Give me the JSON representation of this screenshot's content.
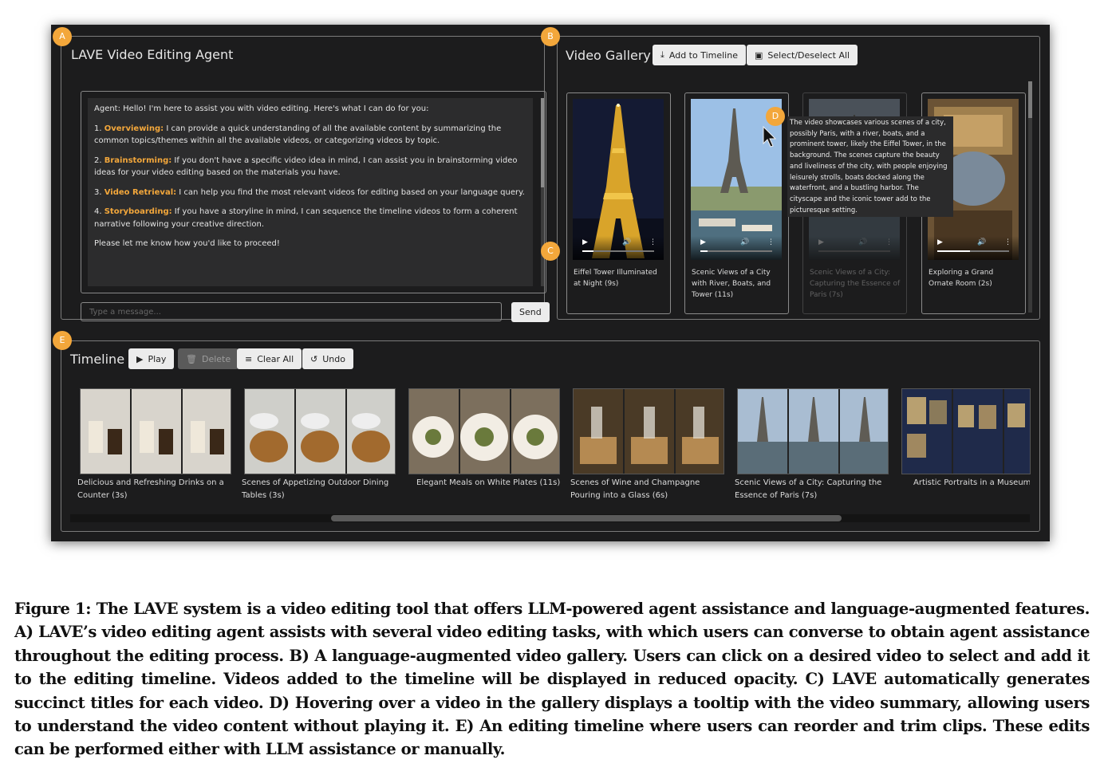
{
  "panels": {
    "A": {
      "badge": "A",
      "title": "LAVE Video Editing Agent"
    },
    "B": {
      "badge": "B",
      "title": "Video Gallery"
    },
    "C": {
      "badge": "C"
    },
    "D": {
      "badge": "D"
    },
    "E": {
      "badge": "E",
      "title": "Timeline"
    }
  },
  "chat": {
    "intro": "Agent: Hello! I'm here to assist you with video editing. Here's what I can do for you:",
    "items": [
      {
        "num": "1.",
        "name": "Overviewing:",
        "text": " I can provide a quick understanding of all the available content by summarizing the common topics/themes within all the available videos, or categorizing videos by topic."
      },
      {
        "num": "2.",
        "name": "Brainstorming:",
        "text": " If you don't have a specific video idea in mind, I can assist you in brainstorming video ideas for your video editing based on the materials you have."
      },
      {
        "num": "3.",
        "name": "Video Retrieval:",
        "text": " I can help you find the most relevant videos for editing based on your language query."
      },
      {
        "num": "4.",
        "name": "Storyboarding:",
        "text": " If you have a storyline in mind, I can sequence the timeline videos to form a coherent narrative following your creative direction."
      }
    ],
    "closing": "Please let me know how you'd like to proceed!",
    "placeholder": "Type a message...",
    "send": "Send"
  },
  "gallery": {
    "add_to_timeline": "Add to Timeline",
    "select_all": "Select/Deselect All",
    "cards": [
      {
        "caption": "Eiffel Tower Illuminated at Night (9s)",
        "progress": 0.15
      },
      {
        "caption": "Scenic Views of a City with River, Boats, and Tower (11s)",
        "progress": 0.1
      },
      {
        "caption": "Scenic Views of a City: Capturing the Essence of Paris (7s)",
        "progress": 0.0
      },
      {
        "caption": "Exploring a Grand Ornate Room (2s)",
        "progress": 0.45
      }
    ],
    "tooltip": "The video showcases various scenes of a city, possibly Paris, with a river, boats, and a prominent tower, likely the Eiffel Tower, in the background. The scenes capture the beauty and liveliness of the city, with people enjoying leisurely strolls, boats docked along the waterfront, and a bustling harbor. The cityscape and the iconic tower add to the picturesque setting."
  },
  "timeline": {
    "play": "Play",
    "delete": "Delete",
    "clear_all": "Clear All",
    "undo": "Undo",
    "clips": [
      {
        "caption": "Delicious and Refreshing Drinks on a Counter (3s)"
      },
      {
        "caption": "Scenes of Appetizing Outdoor Dining Tables (3s)"
      },
      {
        "caption": "Elegant Meals on White Plates (11s)"
      },
      {
        "caption": "Scenes of Wine and Champagne Pouring into a Glass (6s)"
      },
      {
        "caption": "Scenic Views of a City: Capturing the Essence of Paris (7s)"
      },
      {
        "caption": "Artistic Portraits in a Museum ("
      }
    ]
  },
  "caption": {
    "label": "Figure 1:",
    "text": " The LAVE system is a video editing tool that offers LLM-powered agent assistance and language-augmented features. A) LAVE’s video editing agent assists with several video editing tasks, with which users can converse to obtain agent assistance throughout the editing process. B) A language-augmented video gallery. Users can click on a desired video to select and add it to the editing timeline. Videos added to the timeline will be displayed in reduced opacity. C) LAVE automatically generates succinct titles for each video. D) Hovering over a video in the gallery displays a tooltip with the video summary, allowing users to understand the video content without playing it. E) An editing timeline where users can reorder and trim clips. These edits can be performed either with LLM assistance or manually."
  },
  "colors": {
    "accent": "#f3a73b",
    "app_bg": "#1c1c1d"
  }
}
